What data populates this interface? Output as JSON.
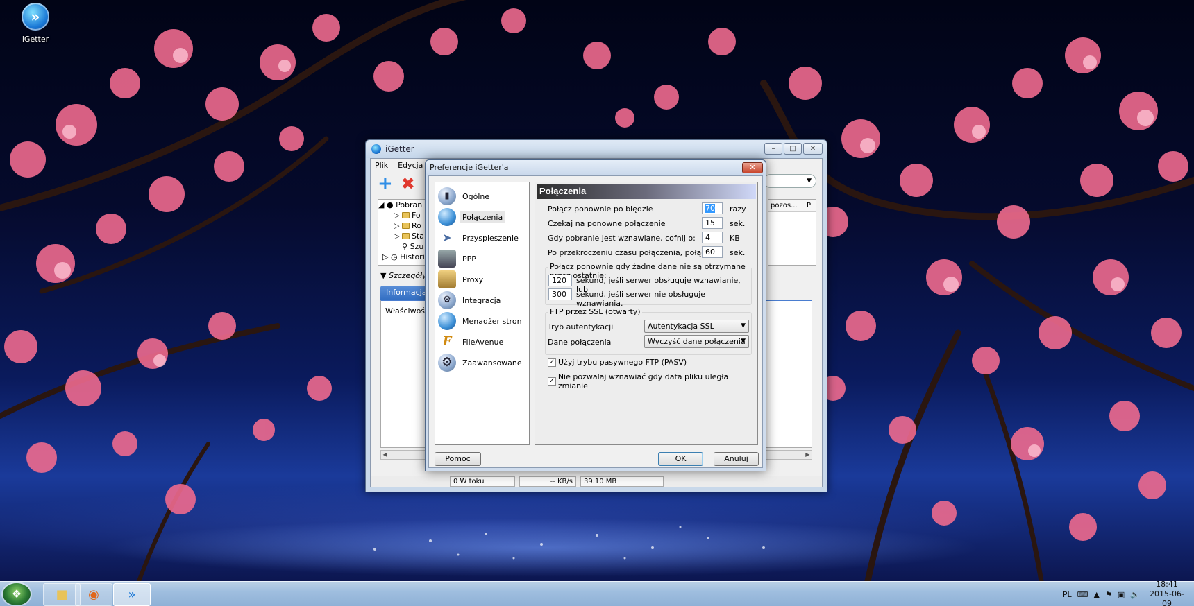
{
  "desktop": {
    "icon_label": "iGetter"
  },
  "main_window": {
    "title": "iGetter",
    "menu": [
      "Plik",
      "Edycja"
    ],
    "tree": [
      "Pobran",
      "Fo",
      "Ro",
      "Sta",
      "Szu",
      "Histori"
    ],
    "columns": [
      "pozos...",
      "P"
    ],
    "details_label": "Szczegóły:",
    "details_tab": "Informacja o",
    "property_label": "Właściwość",
    "status": {
      "active": "0  W toku",
      "speed": "-- KB/s",
      "size": "39.10 MB"
    }
  },
  "prefs": {
    "title": "Preferencje iGetter'a",
    "categories": [
      {
        "label": "Ogólne",
        "icon": "switch-icon"
      },
      {
        "label": "Połączenia",
        "icon": "globe-icon"
      },
      {
        "label": "Przyspieszenie",
        "icon": "rocket-icon"
      },
      {
        "label": "PPP",
        "icon": "phone-icon"
      },
      {
        "label": "Proxy",
        "icon": "proxy-icon"
      },
      {
        "label": "Integracja",
        "icon": "integration-icon"
      },
      {
        "label": "Menadżer stron",
        "icon": "site-manager-icon"
      },
      {
        "label": "FileAvenue",
        "icon": "fileavenue-icon"
      },
      {
        "label": "Zaawansowane",
        "icon": "gear-icon"
      }
    ],
    "selected_category": "Połączenia",
    "pane_title": "Połączenia",
    "settings": [
      {
        "label": "Połącz ponownie po błędzie",
        "value": "70",
        "unit": "razy"
      },
      {
        "label": "Czekaj na ponowne połączenie",
        "value": "15",
        "unit": "sek."
      },
      {
        "label": "Gdy pobranie jest wznawiane, cofnij o:",
        "value": "4",
        "unit": "KB"
      },
      {
        "label": "Po przekroczeniu czasu połączenia, połącz",
        "value": "60",
        "unit": "sek."
      }
    ],
    "reconnect_group": {
      "title": "Połącz ponownie gdy żadne dane nie są otrzymane przez ostatnie:",
      "rows": [
        {
          "value": "120",
          "label": "sekund, jeśli serwer obsługuje wznawianie, lub"
        },
        {
          "value": "300",
          "label": "sekund, jeśli serwer nie obsługuje wznawiania."
        }
      ]
    },
    "ftp_group": {
      "title": "FTP przez SSL (otwarty)",
      "auth_label": "Tryb autentykacji",
      "auth_value": "Autentykacja SSL",
      "data_label": "Dane połączenia",
      "data_value": "Wyczyść dane połączenia"
    },
    "checkboxes": [
      {
        "label": "Użyj trybu pasywnego FTP (PASV)",
        "checked": true
      },
      {
        "label": "Nie pozwalaj wznawiać gdy data pliku uległa zmianie",
        "checked": true
      }
    ],
    "buttons": {
      "help": "Pomoc",
      "ok": "OK",
      "cancel": "Anuluj"
    }
  },
  "taskbar": {
    "language": "PL",
    "time": "18:41",
    "date": "2015-06-09"
  }
}
